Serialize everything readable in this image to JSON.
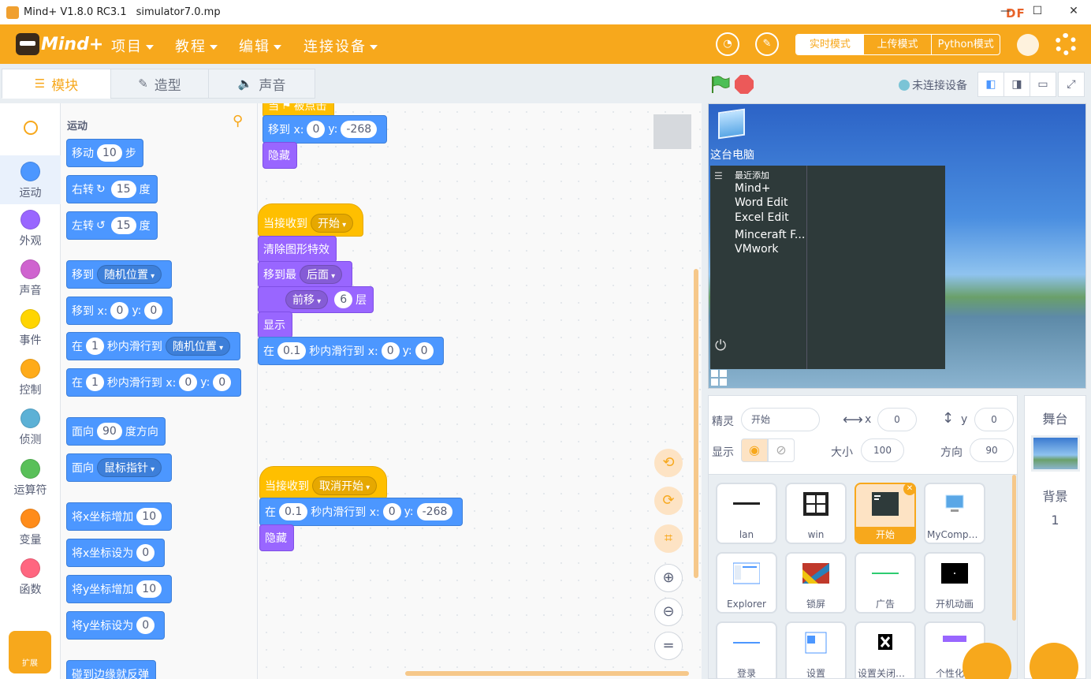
{
  "titlebar": {
    "app_name": "Mind+ V1.8.0 RC3.1",
    "file_name": "simulator7.0.mp",
    "brand_badge": "DF",
    "brand_url": "mc.DFRobot.com.cn",
    "minimize": "—",
    "maximize": "☐",
    "close": "✕"
  },
  "menubar": {
    "brand": "Mind+",
    "items": [
      "项目",
      "教程",
      "编辑",
      "连接设备"
    ],
    "modes": [
      "实时模式",
      "上传模式",
      "Python模式"
    ],
    "active_mode": "实时模式",
    "colors": {
      "accent": "#f7a81c"
    }
  },
  "tabs": [
    {
      "label": "模块",
      "icon": "☰",
      "active": true
    },
    {
      "label": "造型",
      "icon": "✎",
      "active": false
    },
    {
      "label": "声音",
      "icon": "🔈",
      "active": false
    }
  ],
  "stage_controls": {
    "connection_status": "未连接设备",
    "layout_icons": [
      "◧",
      "◨",
      "▭",
      "⤢"
    ]
  },
  "categories": [
    {
      "label": "运动",
      "color": "#4c97ff",
      "selected": true
    },
    {
      "label": "外观",
      "color": "#9966ff"
    },
    {
      "label": "声音",
      "color": "#cf63cf"
    },
    {
      "label": "事件",
      "color": "#ffd500"
    },
    {
      "label": "控制",
      "color": "#ffab19"
    },
    {
      "label": "侦测",
      "color": "#5cb1d6"
    },
    {
      "label": "运算符",
      "color": "#59c059"
    },
    {
      "label": "变量",
      "color": "#ff8c1a"
    },
    {
      "label": "函数",
      "color": "#ff6680"
    }
  ],
  "extension": {
    "label": "扩展"
  },
  "palette": {
    "title": "运动",
    "blocks": {
      "move": {
        "a": "移动",
        "v": "10",
        "b": "步"
      },
      "turn_right": {
        "a": "右转",
        "icon": "↻",
        "v": "15",
        "b": "度"
      },
      "turn_left": {
        "a": "左转",
        "icon": "↺",
        "v": "15",
        "b": "度"
      },
      "goto": {
        "a": "移到",
        "d": "随机位置"
      },
      "goto_xy": {
        "a": "移到 x:",
        "x": "0",
        "b": "y:",
        "y": "0"
      },
      "glide": {
        "a": "在",
        "v": "1",
        "b": "秒内滑行到",
        "d": "随机位置"
      },
      "glide_xy": {
        "a": "在",
        "v": "1",
        "b": "秒内滑行到 x:",
        "x": "0",
        "c": "y:",
        "y": "0"
      },
      "point_dir": {
        "a": "面向",
        "v": "90",
        "b": "度方向"
      },
      "point_towards": {
        "a": "面向",
        "d": "鼠标指针"
      },
      "change_x": {
        "a": "将x坐标增加",
        "v": "10"
      },
      "set_x": {
        "a": "将x坐标设为",
        "v": "0"
      },
      "change_y": {
        "a": "将y坐标增加",
        "v": "10"
      },
      "set_y": {
        "a": "将y坐标设为",
        "v": "0"
      },
      "bounce": {
        "a": "碰到边缘就反弹"
      }
    }
  },
  "scripts": {
    "s1": {
      "hat": "当",
      "hat_b": "被点击",
      "move": {
        "a": "移到 x:",
        "x": "0",
        "b": "y:",
        "y": "-268"
      },
      "hide": "隐藏"
    },
    "s2": {
      "hat": {
        "a": "当接收到",
        "d": "开始"
      },
      "clear": "清除图形特效",
      "layer": {
        "a": "移到最",
        "d": "后面"
      },
      "forward": {
        "d": "前移",
        "v": "6",
        "b": "层"
      },
      "show": "显示",
      "glide": {
        "a": "在",
        "v": "0.1",
        "b": "秒内滑行到 x:",
        "x": "0",
        "c": "y:",
        "y": "0"
      }
    },
    "s3": {
      "hat": {
        "a": "当接收到",
        "d": "取消开始"
      },
      "glide": {
        "a": "在",
        "v": "0.1",
        "b": "秒内滑行到 x:",
        "x": "0",
        "c": "y:",
        "y": "-268"
      },
      "hide": "隐藏"
    },
    "zoom_icons": [
      "⟲",
      "⟳",
      "⌗",
      "⊕",
      "⊖",
      "="
    ]
  },
  "stage": {
    "desktop_icon_label": "这台电脑",
    "menu_items": [
      "最近添加",
      "Mind+",
      "Word Edit",
      "Excel Edit",
      "Minceraft F...",
      "VMwork"
    ],
    "power_icon": "⏻"
  },
  "sprite_info": {
    "sprite_label": "精灵",
    "sprite_name": "开始",
    "x_label": "x",
    "x_value": "0",
    "y_label": "y",
    "y_value": "0",
    "show_label": "显示",
    "size_label": "大小",
    "size_value": "100",
    "direction_label": "方向",
    "direction_value": "90"
  },
  "sprites": [
    {
      "name": "lan"
    },
    {
      "name": "win"
    },
    {
      "name": "开始",
      "selected": true
    },
    {
      "name": "MyCompu..."
    },
    {
      "name": "Explorer"
    },
    {
      "name": "锁屏"
    },
    {
      "name": "广告"
    },
    {
      "name": "开机动画"
    },
    {
      "name": "登录"
    },
    {
      "name": "设置"
    },
    {
      "name": "设置关闭按钮"
    },
    {
      "name": "个性化设"
    }
  ],
  "stage_panel": {
    "title": "舞台",
    "backdrop_label": "背景",
    "backdrop_count": "1"
  }
}
